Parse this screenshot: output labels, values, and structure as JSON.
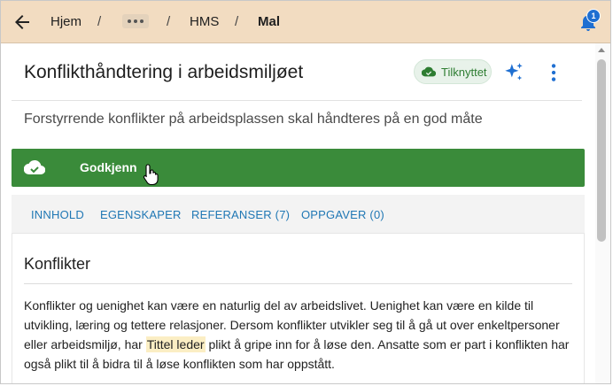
{
  "breadcrumb": {
    "items": [
      "Hjem",
      "HMS",
      "Mal"
    ],
    "separator": "/"
  },
  "notifications": {
    "count": "1"
  },
  "page": {
    "title": "Konflikthåndtering i arbeidsmiljøet",
    "status_chip": "Tilknyttet",
    "subtitle": "Forstyrrende konflikter på arbeidsplassen skal håndteres på en god måte"
  },
  "approve_button": {
    "label": "Godkjenn"
  },
  "tabs": [
    "INNHOLD",
    "EGENSKAPER",
    "REFERANSER (7)",
    "OPPGAVER (0)"
  ],
  "content": {
    "heading": "Konflikter",
    "paragraph_before": "Konflikter og uenighet kan være en naturlig del av arbeidslivet. Uenighet kan være en kilde til utvikling, læring og tettere relasjoner. Dersom konflikter utvikler seg til å gå ut over enkeltpersoner eller arbeidsmiljø, har ",
    "highlight": "Tittel leder",
    "paragraph_after": " plikt å gripe inn for å løse den. Ansatte som er part i konflikten har også plikt til å bidra til å løse konflikten som har oppstått."
  },
  "colors": {
    "topbar": "#f2dcc1",
    "approve": "#3a8b3a",
    "tab_text": "#1f77b4",
    "chip_text": "#2e7d32",
    "accent_icon": "#1f6fd1"
  },
  "icons": [
    "back-arrow-icon",
    "more-dots-icon",
    "bell-icon",
    "cloud-check-icon",
    "sparkle-icon",
    "kebab-icon",
    "hand-cursor-icon"
  ]
}
